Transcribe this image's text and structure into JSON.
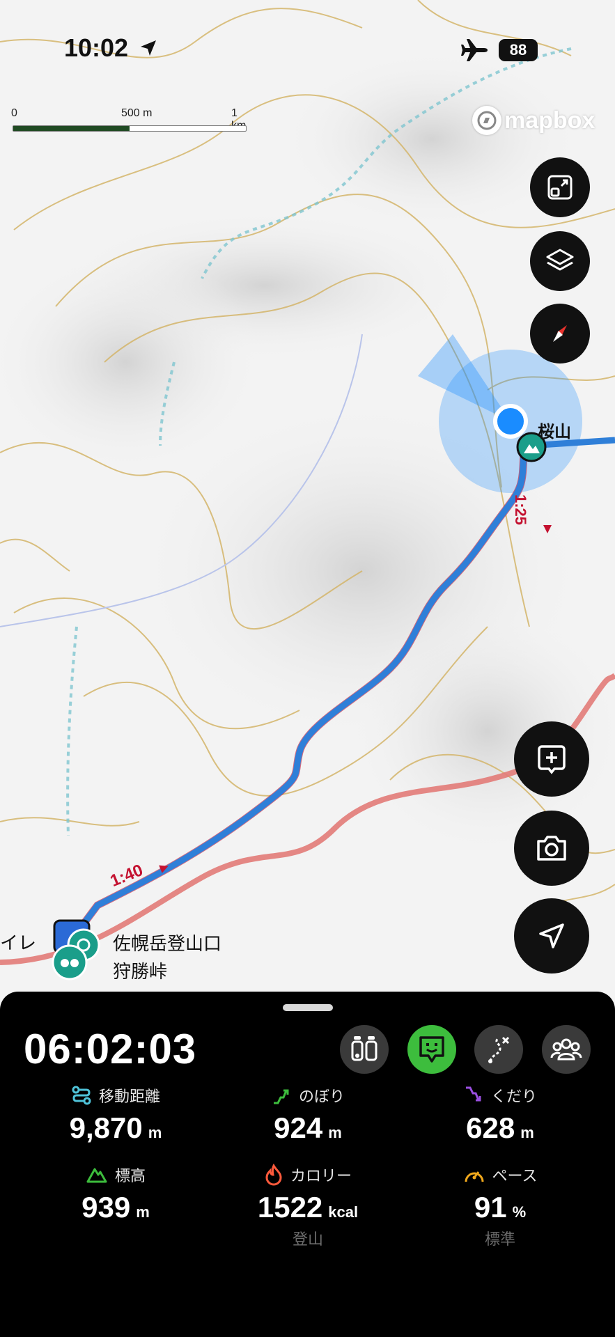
{
  "status_bar": {
    "time": "10:02",
    "battery": "88",
    "icons": [
      "location-arrow-icon",
      "airplane-icon"
    ]
  },
  "map": {
    "scale": {
      "labels": [
        "0",
        "500 m",
        "1 km"
      ]
    },
    "attribution": "mapbox",
    "peak_label": "桜山",
    "segment_times": [
      "1:40",
      "1:25"
    ],
    "trailhead_labels": [
      "佐幌岳登山口",
      "狩勝峠"
    ],
    "partial_label": "イレ",
    "controls": [
      "fullscreen-icon",
      "layers-icon",
      "compass-icon",
      "add-marker-icon",
      "camera-icon",
      "navigate-icon"
    ],
    "colors": {
      "track": "#2f7fd8",
      "road": "#e27b78",
      "contour": "#d4b56a",
      "user_location": "#1a8cff"
    }
  },
  "activity": {
    "elapsed_time": "06:02:03",
    "modes": [
      "gear-icon",
      "face-icon",
      "route-icon",
      "group-icon"
    ],
    "active_mode": "face-icon",
    "stats": [
      {
        "icon": "distance-icon",
        "label": "移動距離",
        "value": "9,870",
        "unit": "m",
        "sub": ""
      },
      {
        "icon": "ascent-icon",
        "label": "のぼり",
        "value": "924",
        "unit": "m",
        "sub": ""
      },
      {
        "icon": "descent-icon",
        "label": "くだり",
        "value": "628",
        "unit": "m",
        "sub": ""
      },
      {
        "icon": "elevation-icon",
        "label": "標高",
        "value": "939",
        "unit": "m",
        "sub": ""
      },
      {
        "icon": "calorie-icon",
        "label": "カロリー",
        "value": "1522",
        "unit": "kcal",
        "sub": "登山"
      },
      {
        "icon": "pace-icon",
        "label": "ペース",
        "value": "91",
        "unit": "%",
        "sub": "標準"
      }
    ],
    "colors": {
      "active_mode": "#3dbd3d",
      "distance": "#4fc3d9",
      "ascent": "#3dbd3d",
      "descent": "#9a4fe0",
      "elevation": "#3dbd3d",
      "calorie": "#ff5a3c",
      "pace": "#f0a81c"
    }
  }
}
